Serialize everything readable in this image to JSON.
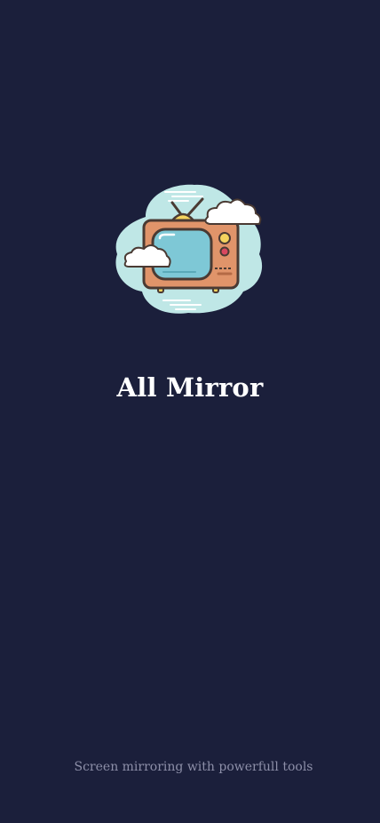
{
  "app": {
    "title": "All Mirror",
    "tagline": "Screen mirroring with powerfull tools",
    "logo_icon": "retro-tv-icon"
  },
  "colors": {
    "background": "#1b1f3b",
    "title": "#ffffff",
    "tagline": "#8d8fa8",
    "blob": "#bfe7e6",
    "tv_body": "#e0946a",
    "tv_screen": "#7ec8d6",
    "knob_yellow": "#f4d35e",
    "knob_red": "#d9485f"
  }
}
